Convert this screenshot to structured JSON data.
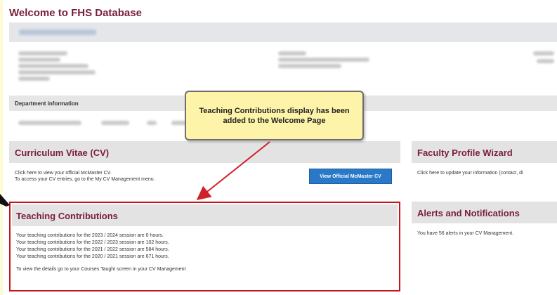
{
  "page": {
    "title": "Welcome to FHS Database"
  },
  "department": {
    "label": "Department information"
  },
  "callout": {
    "text": "Teaching Contributions display has been added to the Welcome Page"
  },
  "cv": {
    "heading": "Curriculum Vitae (CV)",
    "line1": "Click here to view your official McMaster CV.",
    "line2": "To access your CV entries, go to the My CV Management menu.",
    "button_label": "View Official McMaster CV"
  },
  "profile_wizard": {
    "heading": "Faculty Profile Wizard",
    "line1": "Click here to update your information (contact, di"
  },
  "teaching": {
    "heading": "Teaching Contributions",
    "lines": [
      "Your teaching contributions for the 2023 / 2024 session are 0 hours.",
      "Your teaching contributions for the 2022 / 2023 session are 102 hours.",
      "Your teaching contributions for the 2021 / 2022 session are 584 hours.",
      "Your teaching contributions for the 2020 / 2021 session are 671 hours."
    ],
    "footer": "To view the details go to your Courses Taught screen in your CV Management"
  },
  "alerts": {
    "heading": "Alerts and Notifications",
    "line1": "You have 56 alerts in your CV Management."
  },
  "colors": {
    "heading": "#7a1e3a",
    "highlight_border": "#c4161c",
    "callout_bg": "#fdf3a9",
    "button": "#2979c8",
    "frame_bg": "#fefbd6"
  }
}
